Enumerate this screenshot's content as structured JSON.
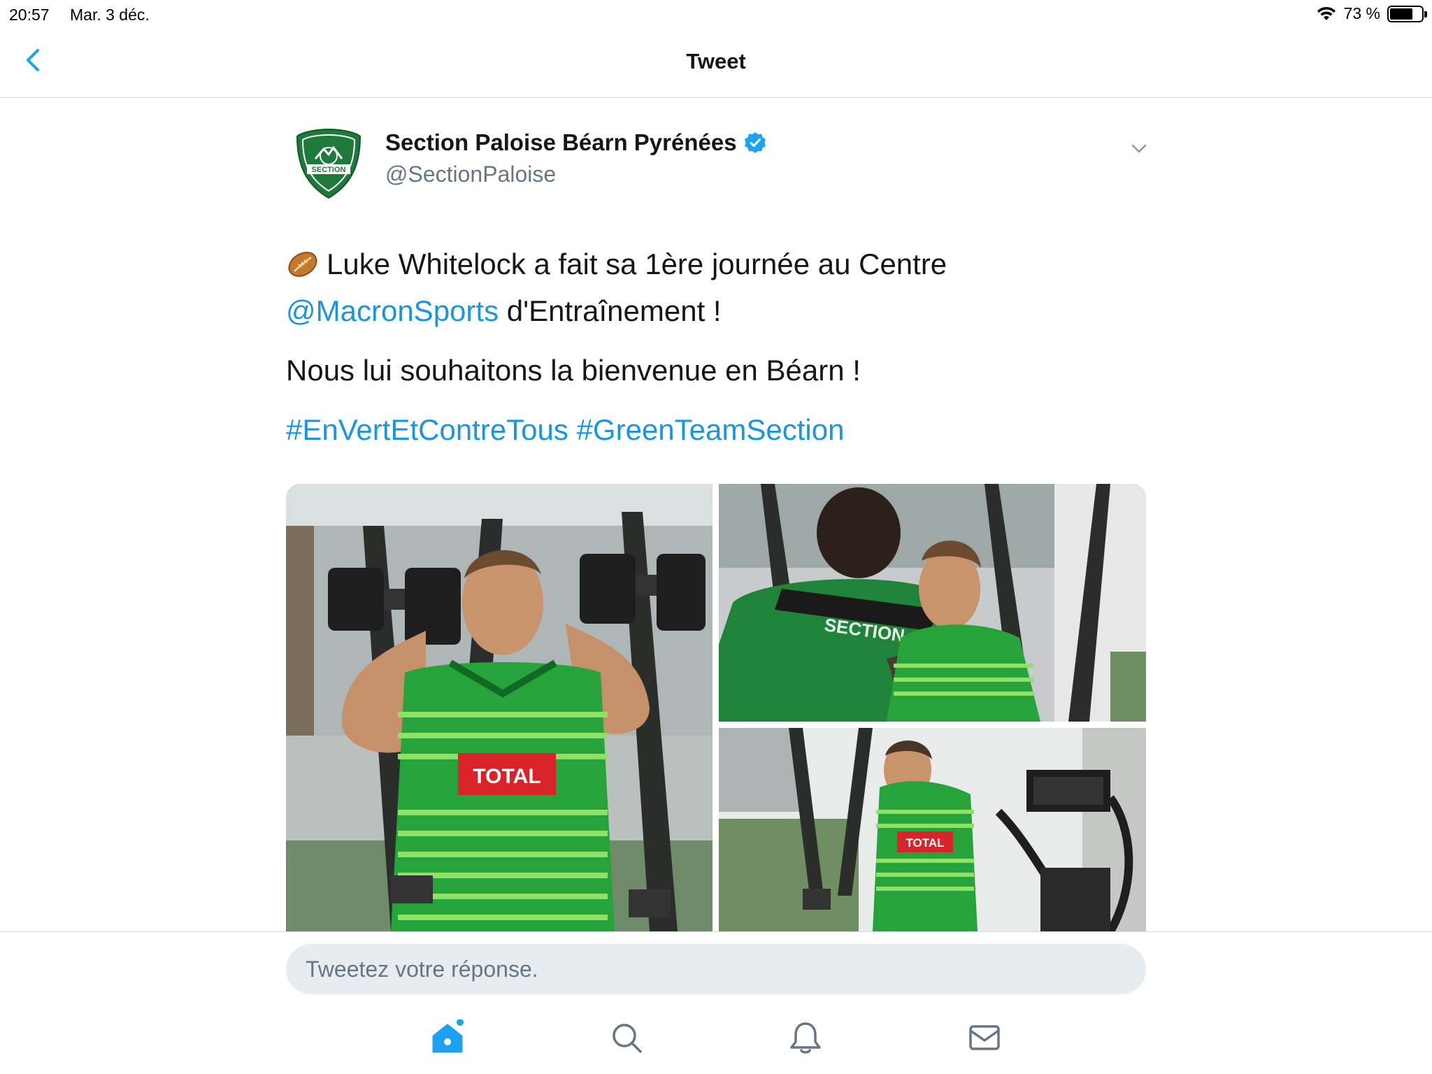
{
  "status": {
    "time": "20:57",
    "date": "Mar. 3 déc.",
    "battery": "73 %",
    "battery_level": 0.73
  },
  "nav": {
    "title": "Tweet"
  },
  "tweet": {
    "display_name": "Section Paloise Béarn Pyrénées",
    "username": "@SectionPaloise",
    "avatar_text": "SECTION",
    "text_line1": "Luke Whitelock a fait sa 1ère journée au Centre",
    "mention": "@MacronSports",
    "text_line2": " d'Entraînement !",
    "text_para2": "Nous lui souhaitons la bienvenue en Béarn !",
    "hashtags": [
      "#EnVertEtContreTous",
      "#GreenTeamSection"
    ]
  },
  "media": {
    "jersey_text_1": "TOTAL",
    "jersey_back_text": "SECTION",
    "jersey_text_2": "TOTAL"
  },
  "reply": {
    "placeholder": "Tweetez votre réponse."
  },
  "tabs": [
    "home-icon",
    "search-icon",
    "notifications-icon",
    "messages-icon"
  ],
  "colors": {
    "link": "#1b95e0",
    "accent": "#1da1f2",
    "jersey_green": "#27a33b"
  }
}
